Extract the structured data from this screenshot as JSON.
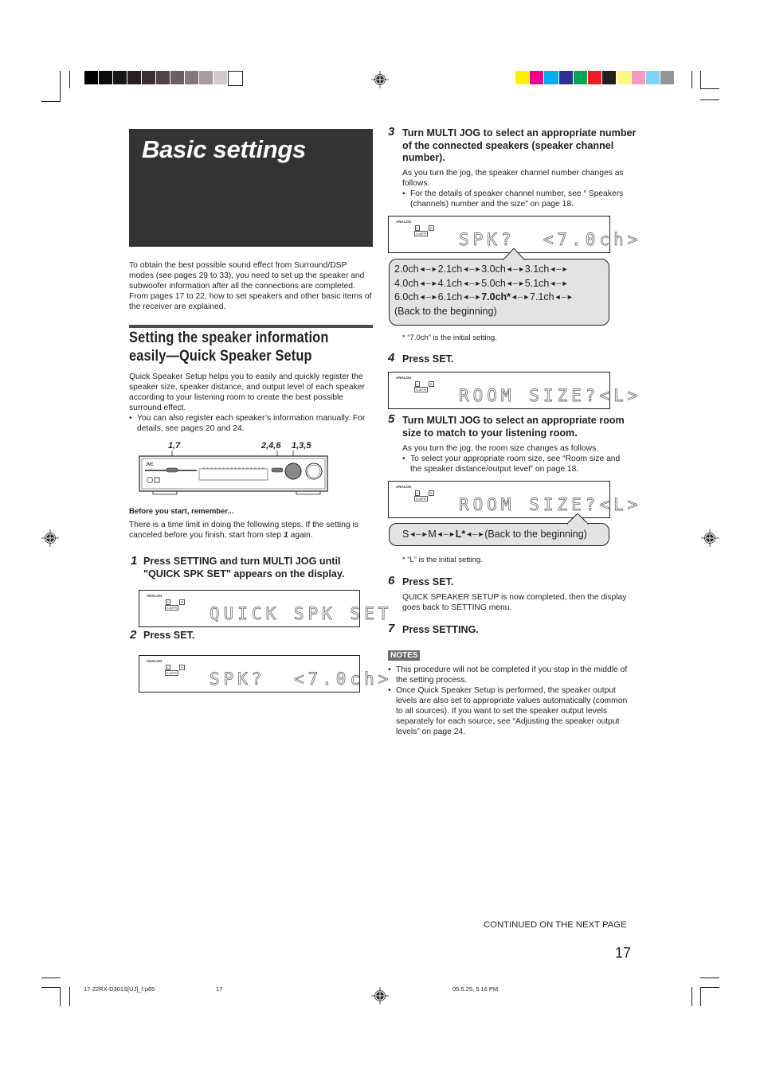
{
  "print_marks": {
    "grayscale_bar": [
      "#000000",
      "#0e0b0b",
      "#1b1616",
      "#262020",
      "#3a3030",
      "#504545",
      "#6b6060",
      "#857a7a",
      "#a69c9c",
      "#d3cbcb",
      "#ffffff"
    ],
    "color_bar": [
      "#fff200",
      "#ec008c",
      "#00aeef",
      "#2e3192",
      "#00a651",
      "#ed1c24",
      "#231f20",
      "#fff685",
      "#f49ac1",
      "#7dd3f7",
      "#939598"
    ]
  },
  "title_box": {
    "title": "Basic settings"
  },
  "intro": "To obtain the best possible sound effect from Surround/DSP modes (see pages 29 to 33), you need to set up the speaker and subwoofer information after all the connections are completed. From pages 17 to 22, how to set speakers and other basic items of the receiver are explained.",
  "section": {
    "title_line1": "Setting the speaker information",
    "title_line2": "easily—Quick Speaker Setup",
    "description": "Quick Speaker Setup helps you to easily and quickly register the speaker size, speaker distance, and output level of each speaker according to your listening room to create the best possible surround effect.",
    "bullet": "You can also register each speaker’s information manually. For details, see pages 20 and 24."
  },
  "device_diagram": {
    "labels": [
      "1,7",
      "2,4,6",
      "1,3,5"
    ],
    "brand": "JVC"
  },
  "before_start": {
    "heading": "Before you start, remember...",
    "text_a": "There is a time limit in doing the following steps. If the setting is canceled before you finish, start from step ",
    "step_ref": "1",
    "text_b": " again."
  },
  "display_labels": {
    "analog": "ANALOG",
    "left": "L",
    "right": "R",
    "subwoofer": "S.WFR"
  },
  "steps": [
    {
      "num": "1",
      "heading": "Press SETTING and turn MULTI JOG until \"QUICK SPK SET\" appears on the display.",
      "display": "QUICK SPK SET"
    },
    {
      "num": "2",
      "heading": "Press SET.",
      "display": "SPK?  <7.0ch>"
    },
    {
      "num": "3",
      "heading": "Turn MULTI JOG to select an appropriate number of the connected speakers (speaker channel number).",
      "body": "As you turn the jog, the speaker channel number changes as follows.",
      "bullet": "For the details of speaker channel number, see “ Speakers (channels) number and the size” on page 18.",
      "display": "SPK?  <7.0ch>",
      "options_rows": [
        [
          "2.0ch",
          "2.1ch",
          "3.0ch",
          "3.1ch"
        ],
        [
          "4.0ch",
          "4.1ch",
          "5.0ch",
          "5.1ch"
        ],
        [
          "6.0ch",
          "6.1ch",
          "7.0ch*",
          "7.1ch"
        ]
      ],
      "options_default": "7.0ch*",
      "options_end": "(Back to the beginning)",
      "footnote": "* “7.0ch” is the initial setting."
    },
    {
      "num": "4",
      "heading": "Press SET.",
      "display": "ROOM SIZE?<L>"
    },
    {
      "num": "5",
      "heading": "Turn MULTI JOG to select an appropriate room size to match to your listening room.",
      "body": "As you turn the jog, the room size changes as follows.",
      "bullet": "To select your appropriate room size, see “Room size and the speaker distance/output level” on page 18.",
      "display": "ROOM SIZE?<L>",
      "options": [
        "S",
        "M",
        "L*"
      ],
      "options_end": "(Back to the beginning)",
      "footnote": "*  “L” is the initial setting."
    },
    {
      "num": "6",
      "heading": "Press SET.",
      "body": "QUICK SPEAKER SETUP is now completed, then the display goes back to SETTING menu."
    },
    {
      "num": "7",
      "heading": "Press SETTING."
    }
  ],
  "notes": {
    "label": "NOTES",
    "items": [
      "This procedure will not be completed if you stop in the middle of the setting process.",
      "Once Quick Speaker Setup is performed, the speaker output levels are also set to appropriate values automatically (common to all sources). If you want to set the speaker output levels separately for each source, see “Adjusting the speaker output levels” on page 24."
    ]
  },
  "footer": {
    "continued": "CONTINUED ON THE NEXT PAGE",
    "page_number": "17",
    "file_name": "17-22RX-D301S[UJ]_f.p65",
    "file_page": "17",
    "timestamp": "05.5.25, 5:16 PM"
  }
}
